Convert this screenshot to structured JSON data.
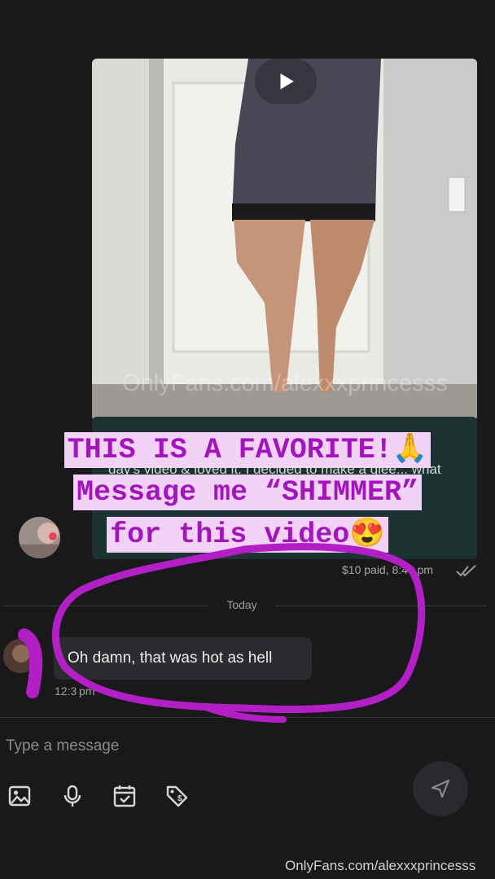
{
  "conversation": {
    "media_message": {
      "watermark": "OnlyFans.com/alexxxprincesss",
      "partial_text": "day's video & loved it. I decided to make a glee... what would you do if you came home",
      "price_status": "$10 paid, 8:46 pm"
    },
    "divider": {
      "label": "Today"
    },
    "incoming_message": {
      "text": "Oh damn, that was hot as hell",
      "time": "12:3 pm"
    }
  },
  "composer": {
    "placeholder": "Type a message",
    "icons": [
      "image-icon",
      "microphone-icon",
      "calendar-check-icon",
      "price-tag-icon",
      "send-icon"
    ]
  },
  "overlay": {
    "caption_lines": [
      "THIS IS A FAVORITE!🙏",
      "Message me “SHIMMER”",
      "for this video😍"
    ],
    "watermark": "OnlyFans.com/alexxxprincesss",
    "colors": {
      "caption_text": "#a215bd",
      "caption_bg": "#f3d2f7",
      "annotation": "#b21fc4"
    }
  },
  "theme": {
    "background": "#19191b",
    "bubble_incoming": "#2c2c30",
    "bubble_outgoing": "#1d3331"
  }
}
